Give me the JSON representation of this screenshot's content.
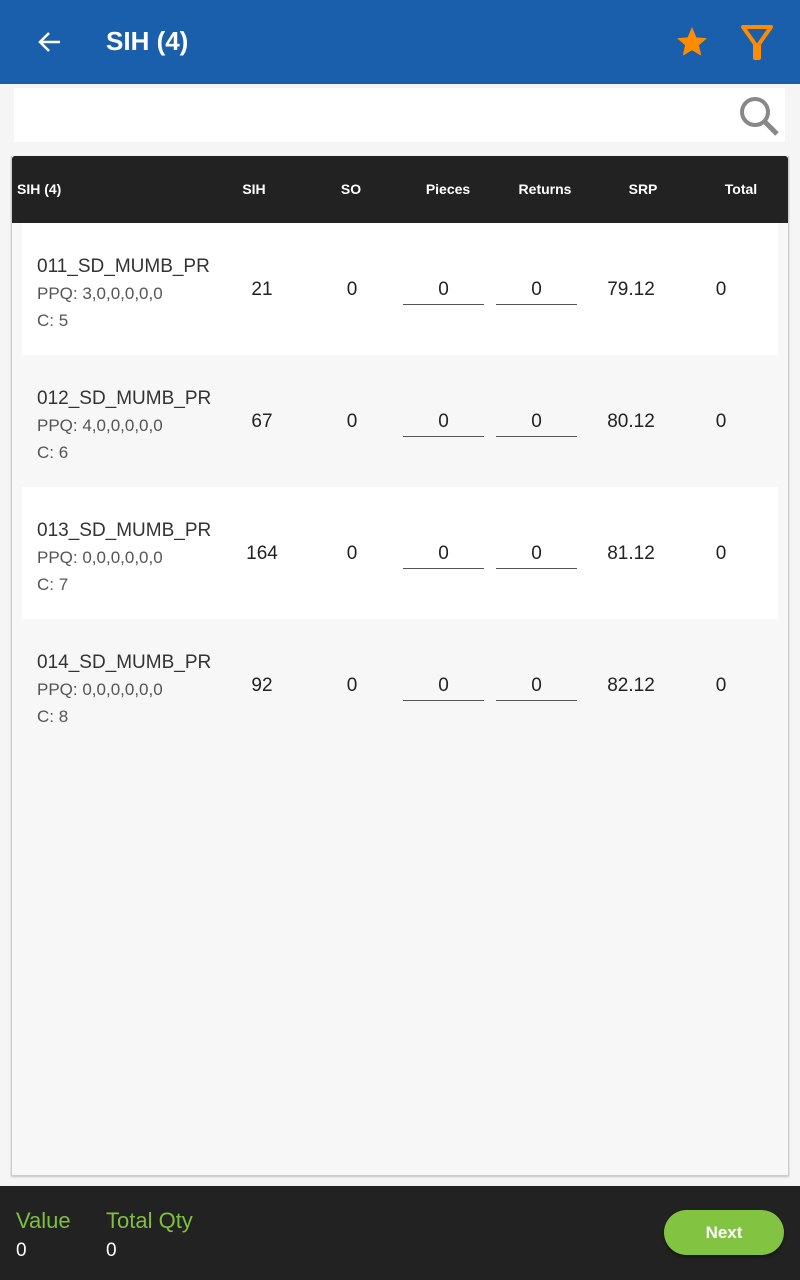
{
  "header": {
    "title": "SIH (4)"
  },
  "search": {
    "placeholder": "",
    "value": ""
  },
  "table": {
    "columns": [
      "SIH (4)",
      "SIH",
      "SO",
      "Pieces",
      "Returns",
      "SRP",
      "Total"
    ],
    "rows": [
      {
        "name": "011_SD_MUMB_PR",
        "ppq": "PPQ: 3,0,0,0,0,0",
        "c": "C: 5",
        "sih": "21",
        "so": "0",
        "pieces": "0",
        "returns": "0",
        "srp": "79.12",
        "total": "0"
      },
      {
        "name": "012_SD_MUMB_PR",
        "ppq": "PPQ: 4,0,0,0,0,0",
        "c": "C: 6",
        "sih": "67",
        "so": "0",
        "pieces": "0",
        "returns": "0",
        "srp": "80.12",
        "total": "0"
      },
      {
        "name": "013_SD_MUMB_PR",
        "ppq": "PPQ: 0,0,0,0,0,0",
        "c": "C: 7",
        "sih": "164",
        "so": "0",
        "pieces": "0",
        "returns": "0",
        "srp": "81.12",
        "total": "0"
      },
      {
        "name": "014_SD_MUMB_PR",
        "ppq": "PPQ: 0,0,0,0,0,0",
        "c": "C: 8",
        "sih": "92",
        "so": "0",
        "pieces": "0",
        "returns": "0",
        "srp": "82.12",
        "total": "0"
      }
    ]
  },
  "footer": {
    "value_label": "Value",
    "value": "0",
    "qty_label": "Total Qty",
    "qty": "0",
    "next_label": "Next"
  },
  "colors": {
    "primary": "#1a5fab",
    "accent": "#ff8c00",
    "green": "#82c341",
    "dark": "#222222"
  }
}
